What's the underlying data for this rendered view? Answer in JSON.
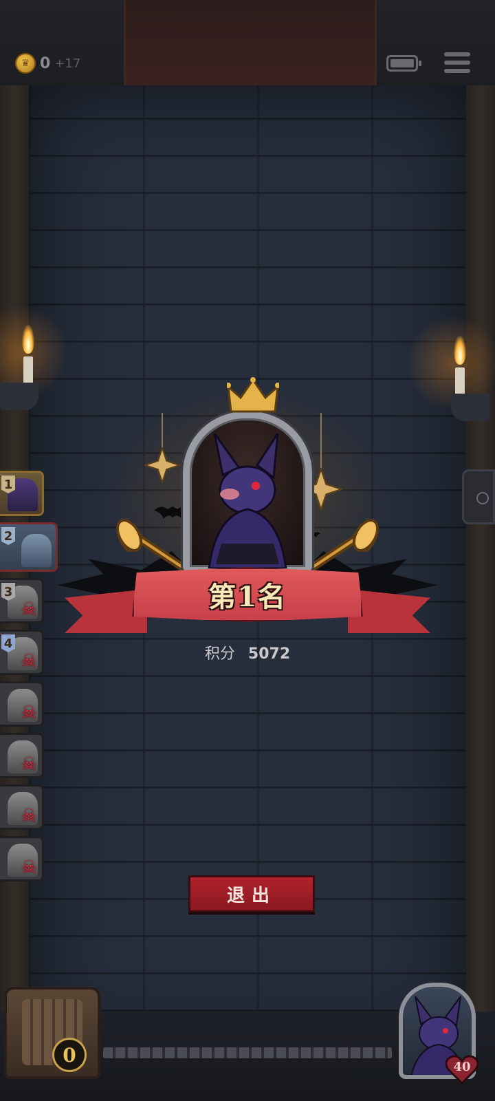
{
  "hud": {
    "coin_count": "0",
    "coin_gain": "+17",
    "menu_icon": "hamburger-menu-icon",
    "battery_icon": "battery-icon"
  },
  "leaderboard": [
    {
      "rank": "1",
      "portrait": "bat-character",
      "eliminated": false
    },
    {
      "rank": "2",
      "portrait": "elf-character",
      "eliminated": false
    },
    {
      "rank": "3",
      "portrait": "hooded-character",
      "eliminated": true
    },
    {
      "rank": "4",
      "portrait": "knight-character",
      "eliminated": true
    },
    {
      "rank": "",
      "portrait": "monster-character",
      "eliminated": true
    },
    {
      "rank": "",
      "portrait": "ghost-girl-character",
      "eliminated": true
    },
    {
      "rank": "",
      "portrait": "rabbit-character",
      "eliminated": true
    },
    {
      "rank": "",
      "portrait": "zombie-character",
      "eliminated": true
    }
  ],
  "result": {
    "title": "第1名",
    "score_label": "积分",
    "score_value": "5072"
  },
  "exit_button": {
    "label": "退出"
  },
  "chest": {
    "count": "0"
  },
  "player": {
    "hp": "40"
  },
  "colors": {
    "ribbon": "#d84a50",
    "exit_button": "#a11c26",
    "title_text": "#fbe8b8",
    "wall": "#262d3b"
  }
}
